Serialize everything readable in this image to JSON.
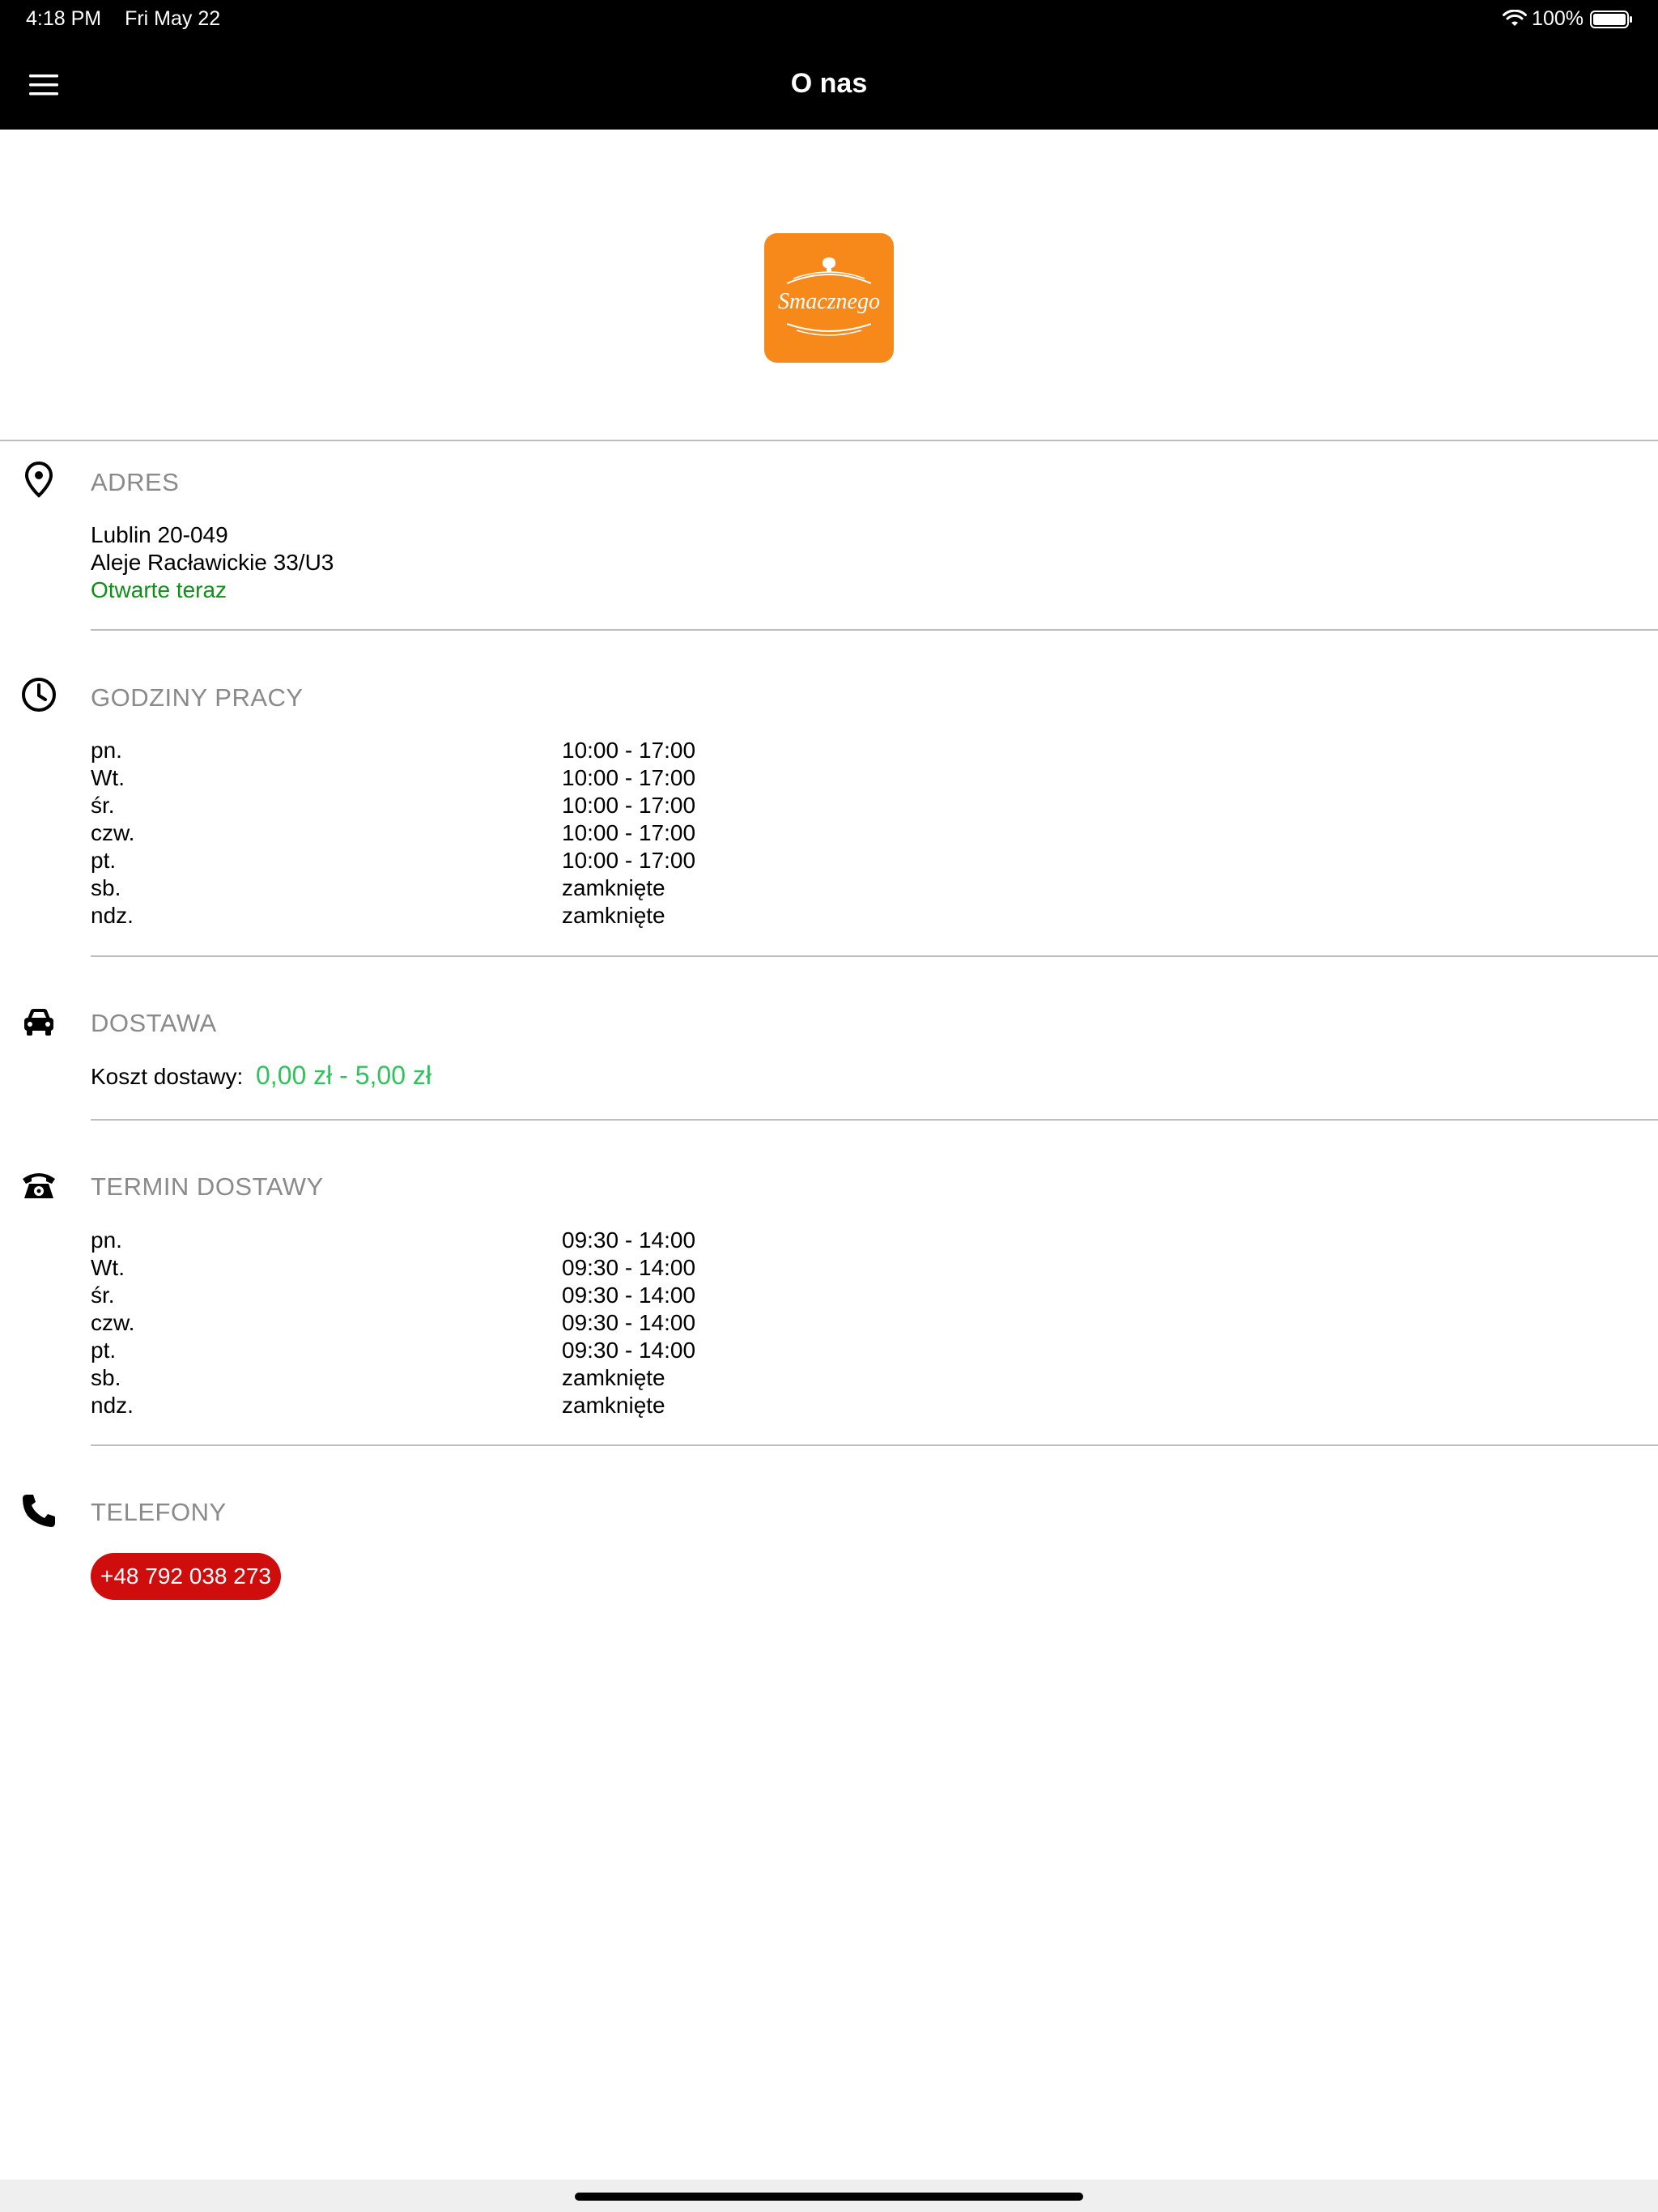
{
  "status_bar": {
    "time": "4:18 PM",
    "date": "Fri May 22",
    "battery": "100%"
  },
  "nav": {
    "title": "O nas",
    "menu_icon": "hamburger-menu-icon"
  },
  "logo": {
    "text": "Smacznego",
    "background_color": "#F7891B"
  },
  "address": {
    "title": "ADRES",
    "line1": "Lublin 20-049",
    "line2": "Aleje Racławickie 33/U3",
    "open_status": "Otwarte teraz",
    "icon": "location-pin-icon"
  },
  "opening_hours": {
    "title": "GODZINY PRACY",
    "icon": "clock-icon",
    "rows": [
      {
        "day": "pn.",
        "time": "10:00 - 17:00"
      },
      {
        "day": "Wt.",
        "time": "10:00 - 17:00"
      },
      {
        "day": "śr.",
        "time": "10:00 - 17:00"
      },
      {
        "day": "czw.",
        "time": "10:00 - 17:00"
      },
      {
        "day": "pt.",
        "time": "10:00 - 17:00"
      },
      {
        "day": "sb.",
        "time": "zamknięte"
      },
      {
        "day": "ndz.",
        "time": "zamknięte"
      }
    ]
  },
  "delivery": {
    "title": "DOSTAWA",
    "icon": "car-icon",
    "fee_label": "Koszt dostawy:",
    "fee_value": "0,00 zł - 5,00 zł"
  },
  "delivery_times": {
    "title": "TERMIN DOSTAWY",
    "icon": "rotary-phone-icon",
    "rows": [
      {
        "day": "pn.",
        "time": "09:30 - 14:00"
      },
      {
        "day": "Wt.",
        "time": "09:30 - 14:00"
      },
      {
        "day": "śr.",
        "time": "09:30 - 14:00"
      },
      {
        "day": "czw.",
        "time": "09:30 - 14:00"
      },
      {
        "day": "pt.",
        "time": "09:30 - 14:00"
      },
      {
        "day": "sb.",
        "time": "zamknięte"
      },
      {
        "day": "ndz.",
        "time": "zamknięte"
      }
    ]
  },
  "phones": {
    "title": "TELEFONY",
    "icon": "phone-handset-icon",
    "numbers": [
      "+48 792 038 273"
    ]
  },
  "colors": {
    "header": "#000000",
    "open_status": "#0E8F17",
    "fee_value": "#2EC45B",
    "phone_button": "#D00D0D"
  }
}
